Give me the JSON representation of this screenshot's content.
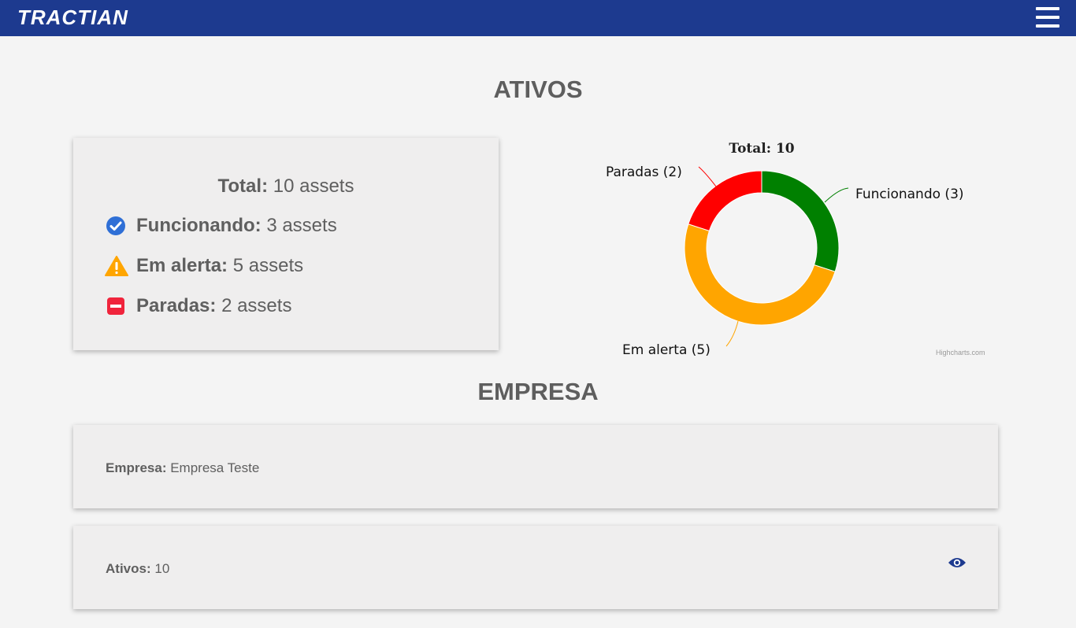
{
  "header": {
    "brand": "TRACTIAN"
  },
  "sections": {
    "ativos_title": "ATIVOS",
    "empresa_title": "EMPRESA"
  },
  "summary": {
    "total_label": "Total:",
    "total_value": "10 assets",
    "rows": [
      {
        "label": "Funcionando:",
        "value": "3 assets",
        "icon": "check-circle-icon",
        "color": "#2f6fd6"
      },
      {
        "label": "Em alerta:",
        "value": "5 assets",
        "icon": "warning-icon",
        "color": "#ffa500"
      },
      {
        "label": "Paradas:",
        "value": "2 assets",
        "icon": "stop-icon",
        "color": "#f0243c"
      }
    ]
  },
  "chart_data": {
    "type": "pie",
    "title": "Total: 10",
    "slices": [
      {
        "name": "Funcionando",
        "value": 3,
        "color": "#008000",
        "label": "Funcionando (3)"
      },
      {
        "name": "Em alerta",
        "value": 5,
        "color": "#ffa500",
        "label": "Em alerta (5)"
      },
      {
        "name": "Paradas",
        "value": 2,
        "color": "#ff0000",
        "label": "Paradas (2)"
      }
    ],
    "credits": "Highcharts.com"
  },
  "empresa": {
    "empresa_label": "Empresa:",
    "empresa_value": "Empresa Teste",
    "ativos_label": "Ativos:",
    "ativos_value": "10"
  },
  "colors": {
    "topbar": "#1d3a8f",
    "eye_icon": "#1d3a8f"
  }
}
